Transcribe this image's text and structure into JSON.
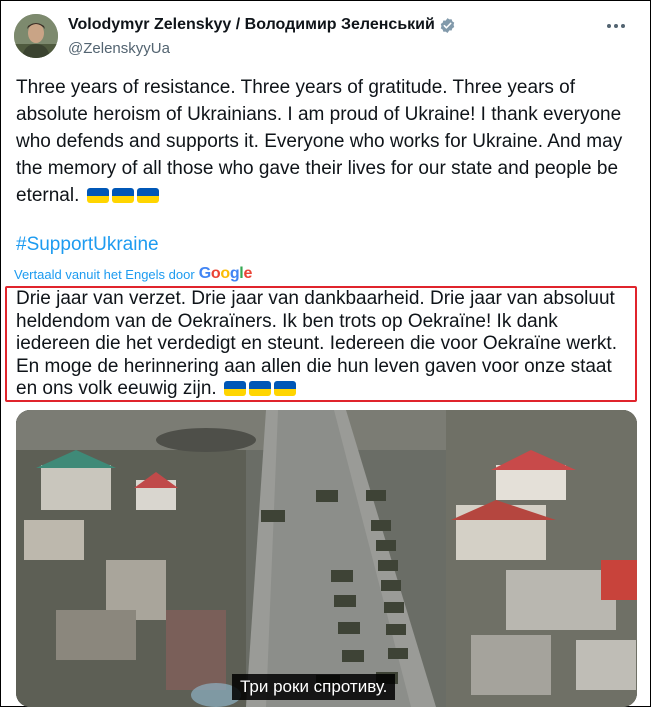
{
  "post": {
    "author_name": "Volodymyr Zelenskyy / Володимир Зеленський",
    "author_handle": "@ZelenskyyUa",
    "text": "Three years of resistance. Three years of gratitude. Three years of absolute heroism of Ukrainians. I am proud of Ukraine! I thank everyone who defends and supports it. Everyone who works for Ukraine. And may the memory of all those who gave their lives for our state and people be eternal.",
    "hashtag": "#SupportUkraine",
    "translated_by_label": "Vertaald vanuit het Engels door",
    "translator_brand": "Google",
    "translation_text": "Drie jaar van verzet. Drie jaar van dankbaarheid. Drie jaar van absoluut heldendom van de Oekraïners. Ik ben trots op Oekraïne! Ik dank iedereen die het verdedigt en steunt. Iedereen die voor Oekraïne werkt. En moge de herinnering aan allen die hun leven gaven voor onze staat en ons volk eeuwig zijn.",
    "video_subtitle": "Три роки спротиву."
  },
  "icons": {
    "verified": "verified-badge-icon",
    "more": "more-options-icon",
    "flag": "ukraine-flag-emoji"
  },
  "colors": {
    "link": "#1d9bf0",
    "highlight_border": "#e0242c",
    "verified": "#829aab"
  }
}
